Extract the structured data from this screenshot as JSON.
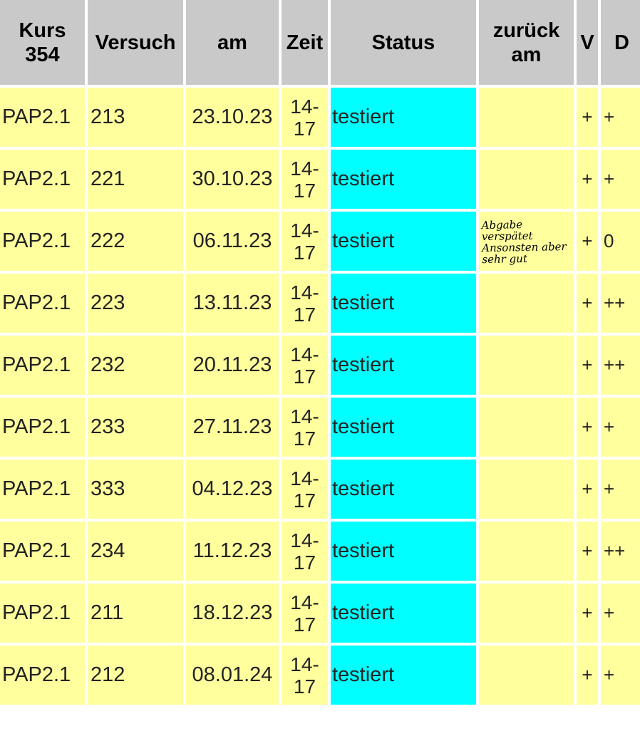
{
  "headers": {
    "kurs_line1": "Kurs",
    "kurs_line2": "354",
    "versuch": "Versuch",
    "am": "am",
    "zeit": "Zeit",
    "status": "Status",
    "zurueck_line1": "zurück",
    "zurueck_line2": "am",
    "v": "V",
    "d": "D"
  },
  "rows": [
    {
      "kurs": "PAP2.1",
      "versuch": "213",
      "am": "23.10.23",
      "zeit_line1": "14-",
      "zeit_line2": "17",
      "status": "testiert",
      "zurueck": "",
      "v": "+",
      "d": "+"
    },
    {
      "kurs": "PAP2.1",
      "versuch": "221",
      "am": "30.10.23",
      "zeit_line1": "14-",
      "zeit_line2": "17",
      "status": "testiert",
      "zurueck": "",
      "v": "+",
      "d": "+"
    },
    {
      "kurs": "PAP2.1",
      "versuch": "222",
      "am": "06.11.23",
      "zeit_line1": "14-",
      "zeit_line2": "17",
      "status": "testiert",
      "zurueck": "",
      "v": "+",
      "d": "0"
    },
    {
      "kurs": "PAP2.1",
      "versuch": "223",
      "am": "13.11.23",
      "zeit_line1": "14-",
      "zeit_line2": "17",
      "status": "testiert",
      "zurueck": "",
      "v": "+",
      "d": "++"
    },
    {
      "kurs": "PAP2.1",
      "versuch": "232",
      "am": "20.11.23",
      "zeit_line1": "14-",
      "zeit_line2": "17",
      "status": "testiert",
      "zurueck": "",
      "v": "+",
      "d": "++"
    },
    {
      "kurs": "PAP2.1",
      "versuch": "233",
      "am": "27.11.23",
      "zeit_line1": "14-",
      "zeit_line2": "17",
      "status": "testiert",
      "zurueck": "",
      "v": "+",
      "d": "+"
    },
    {
      "kurs": "PAP2.1",
      "versuch": "333",
      "am": "04.12.23",
      "zeit_line1": "14-",
      "zeit_line2": "17",
      "status": "testiert",
      "zurueck": "",
      "v": "+",
      "d": "+"
    },
    {
      "kurs": "PAP2.1",
      "versuch": "234",
      "am": "11.12.23",
      "zeit_line1": "14-",
      "zeit_line2": "17",
      "status": "testiert",
      "zurueck": "",
      "v": "+",
      "d": "++"
    },
    {
      "kurs": "PAP2.1",
      "versuch": "211",
      "am": "18.12.23",
      "zeit_line1": "14-",
      "zeit_line2": "17",
      "status": "testiert",
      "zurueck": "",
      "v": "+",
      "d": "+"
    },
    {
      "kurs": "PAP2.1",
      "versuch": "212",
      "am": "08.01.24",
      "zeit_line1": "14-",
      "zeit_line2": "17",
      "status": "testiert",
      "zurueck": "",
      "v": "+",
      "d": "+"
    }
  ],
  "handwritten_note": {
    "line1": "Abgabe verspätet",
    "line2": "Ansonsten aber",
    "line3": "sehr gut"
  },
  "colors": {
    "header_bg": "#c9c9c9",
    "cell_bg": "#ffff9e",
    "status_bg": "#00ffff",
    "grid": "#ffffff"
  }
}
